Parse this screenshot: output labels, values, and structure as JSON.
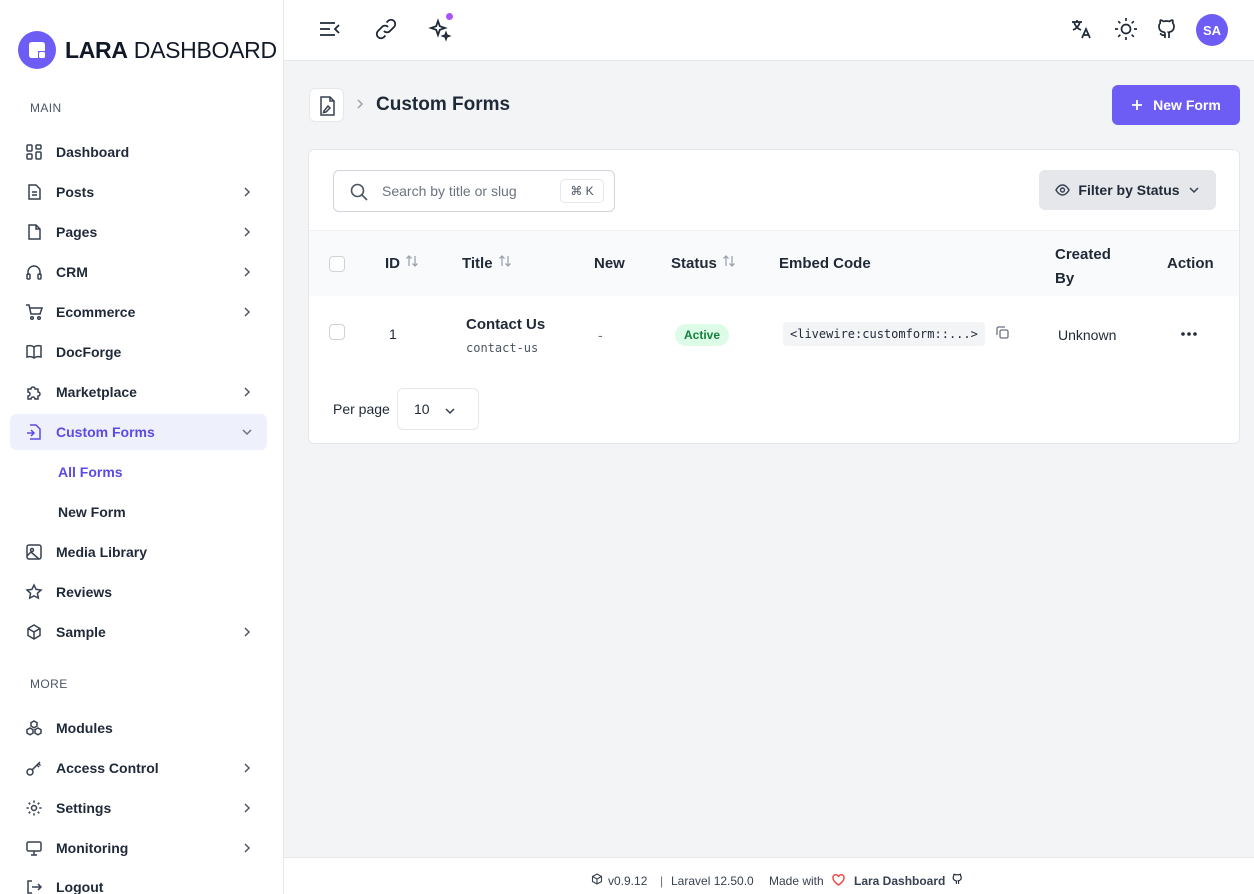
{
  "brand": {
    "bold": "LARA",
    "light": "DASHBOARD"
  },
  "sidebar": {
    "main_label": "MAIN",
    "more_label": "MORE",
    "main_items": [
      {
        "label": "Dashboard",
        "icon": "grid-icon"
      },
      {
        "label": "Posts",
        "icon": "document-icon"
      },
      {
        "label": "Pages",
        "icon": "page-icon"
      },
      {
        "label": "CRM",
        "icon": "headphones-icon"
      },
      {
        "label": "Ecommerce",
        "icon": "cart-icon"
      },
      {
        "label": "DocForge",
        "icon": "book-icon"
      },
      {
        "label": "Marketplace",
        "icon": "puzzle-icon"
      },
      {
        "label": "Custom Forms",
        "icon": "form-icon"
      },
      {
        "label": "Media Library",
        "icon": "image-icon"
      },
      {
        "label": "Reviews",
        "icon": "star-icon"
      },
      {
        "label": "Sample",
        "icon": "cube-icon"
      }
    ],
    "submenu": {
      "all_forms": "All Forms",
      "new_form": "New Form"
    },
    "more_items": [
      {
        "label": "Modules",
        "icon": "modules-icon"
      },
      {
        "label": "Access Control",
        "icon": "key-icon"
      },
      {
        "label": "Settings",
        "icon": "gear-icon"
      },
      {
        "label": "Monitoring",
        "icon": "monitor-icon"
      },
      {
        "label": "Logout",
        "icon": "logout-icon"
      }
    ]
  },
  "header": {
    "avatar_initials": "SA"
  },
  "page": {
    "title": "Custom Forms",
    "new_button": "New Form"
  },
  "toolbar": {
    "search_placeholder": "Search by title or slug",
    "shortcut": "⌘ K",
    "filter_label": "Filter by Status"
  },
  "table": {
    "columns": {
      "id": "ID",
      "title": "Title",
      "new": "New",
      "status": "Status",
      "embed": "Embed Code",
      "created_by_1": "Created",
      "created_by_2": "By",
      "action": "Action"
    },
    "rows": [
      {
        "id": "1",
        "title": "Contact Us",
        "slug": "contact-us",
        "new": "-",
        "status": "Active",
        "embed": "<livewire:customform::...>",
        "created_by": "Unknown"
      }
    ]
  },
  "pagination": {
    "per_page_label": "Per page",
    "per_page_value": "10"
  },
  "footer": {
    "version": "v0.9.12",
    "framework": "Laravel 12.50.0",
    "made_with": "Made with",
    "brand": "Lara Dashboard"
  },
  "colors": {
    "accent": "#6d5df4",
    "active_text": "#5b4be6",
    "badge_bg": "#dcfce7",
    "badge_text": "#15803d"
  }
}
